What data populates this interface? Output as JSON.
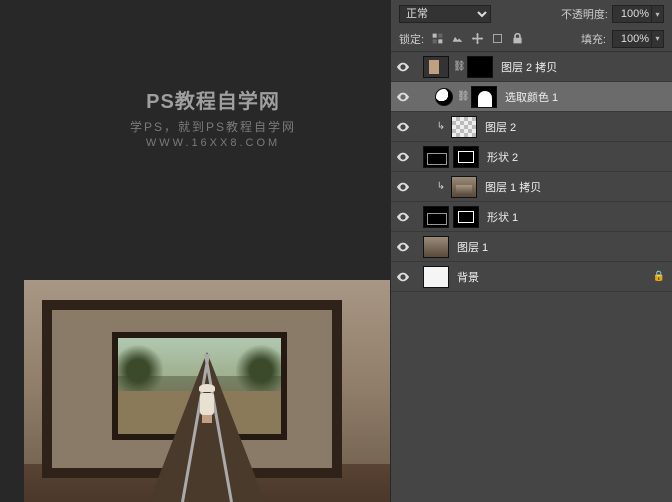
{
  "watermark": {
    "line1": "PS教程自学网",
    "line2": "学PS，就到PS教程自学网",
    "line3": "WWW.16XX8.COM"
  },
  "panel": {
    "blend_mode": "正常",
    "opacity_label": "不透明度:",
    "opacity_value": "100%",
    "lock_label": "锁定:",
    "fill_label": "填充:",
    "fill_value": "100%"
  },
  "layers": [
    {
      "name": "图层 2 拷贝",
      "selected": false,
      "linked": true,
      "thumb": "partial",
      "mask": "black",
      "indent": 0,
      "clip": false
    },
    {
      "name": "选取颜色 1",
      "selected": true,
      "linked": true,
      "thumb": "adjust",
      "mask": "arch",
      "indent": 12,
      "clip": false
    },
    {
      "name": "图层 2",
      "selected": false,
      "linked": false,
      "thumb": "checker",
      "mask": null,
      "indent": 12,
      "clip": true
    },
    {
      "name": "形状 2",
      "selected": false,
      "linked": false,
      "thumb": "shape",
      "mask": "frame",
      "indent": 0,
      "clip": false
    },
    {
      "name": "图层 1 拷贝",
      "selected": false,
      "linked": false,
      "thumb": "railthumb",
      "mask": null,
      "indent": 12,
      "clip": true
    },
    {
      "name": "形状 1",
      "selected": false,
      "linked": false,
      "thumb": "shape",
      "mask": "frame",
      "indent": 0,
      "clip": false
    },
    {
      "name": "图层 1",
      "selected": false,
      "linked": false,
      "thumb": "photo",
      "mask": null,
      "indent": 0,
      "clip": false
    },
    {
      "name": "背景",
      "selected": false,
      "linked": false,
      "thumb": "white",
      "mask": null,
      "indent": 0,
      "clip": false,
      "locked": true
    }
  ]
}
